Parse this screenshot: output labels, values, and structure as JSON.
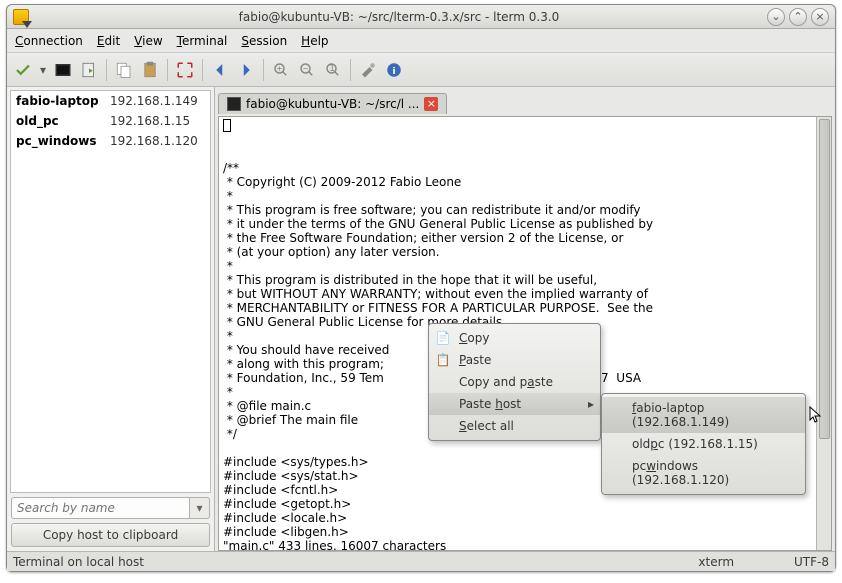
{
  "window": {
    "title": "fabio@kubuntu-VB: ~/src/lterm-0.3.x/src - lterm 0.3.0"
  },
  "menu": {
    "items": [
      {
        "label": "Connection",
        "u": 0
      },
      {
        "label": "Edit",
        "u": 0
      },
      {
        "label": "View",
        "u": 0
      },
      {
        "label": "Terminal",
        "u": 0
      },
      {
        "label": "Session",
        "u": 0
      },
      {
        "label": "Help",
        "u": 0
      }
    ]
  },
  "sidebar": {
    "hosts": [
      {
        "name": "fabio-laptop",
        "ip": "192.168.1.149"
      },
      {
        "name": "old_pc",
        "ip": "192.168.1.15"
      },
      {
        "name": "pc_windows",
        "ip": "192.168.1.120"
      }
    ],
    "search_placeholder": "Search by name",
    "copy_btn": "Copy host to clipboard"
  },
  "tab": {
    "label": "fabio@kubuntu-VB: ~/src/l ..."
  },
  "terminal": {
    "content": "\n/**\n * Copyright (C) 2009-2012 Fabio Leone\n *\n * This program is free software; you can redistribute it and/or modify\n * it under the terms of the GNU General Public License as published by\n * the Free Software Foundation; either version 2 of the License, or\n * (at your option) any later version.\n *\n * This program is distributed in the hope that it will be useful,\n * but WITHOUT ANY WARRANTY; without even the implied warranty of\n * MERCHANTABILITY or FITNESS FOR A PARTICULAR PURPOSE.  See the\n * GNU General Public License for more details.\n *\n * You should have received                           Public License\n * along with this program;                           Software\n * Foundation, Inc., 59 Tem                           on, MA  02111-1307  USA\n *\n * @file main.c\n * @brief The main file\n */\n\n#include <sys/types.h>\n#include <sys/stat.h>\n#include <fcntl.h>\n#include <getopt.h>\n#include <locale.h>\n#include <libgen.h>\n\"main.c\" 433 lines, 16007 characters"
  },
  "context_menu": {
    "items": [
      {
        "icon": "📄",
        "label": "Copy",
        "u": 0
      },
      {
        "icon": "📋",
        "label": "Paste",
        "u": 0
      },
      {
        "icon": "",
        "label": "Copy and paste",
        "u": 9
      },
      {
        "icon": "",
        "label": "Paste host",
        "u": 6,
        "submenu": true,
        "hover": true
      },
      {
        "icon": "",
        "label": "Select all",
        "u": 7
      }
    ]
  },
  "submenu": {
    "items": [
      {
        "label": "fabio-laptop (192.168.1.149)",
        "u": 0,
        "hover": true
      },
      {
        "label": "oldpc (192.168.1.15)",
        "u": 3
      },
      {
        "label": "pcwindows (192.168.1.120)",
        "u": 2
      }
    ]
  },
  "status": {
    "left": "Terminal on local host",
    "term": "xterm",
    "enc": "UTF-8"
  }
}
